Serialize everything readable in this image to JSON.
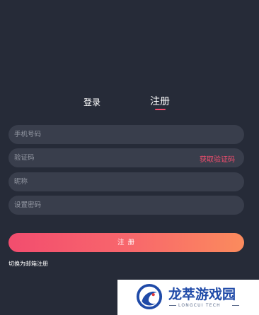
{
  "tabs": {
    "login": "登录",
    "register": "注册",
    "active": "register"
  },
  "form": {
    "phone_placeholder": "手机号码",
    "code_placeholder": "验证码",
    "get_code": "获取验证码",
    "nickname_placeholder": "昵称",
    "password_placeholder": "设置密码",
    "submit": "注 册",
    "switch_email": "切换为邮箱注册"
  },
  "colors": {
    "background": "#262b38",
    "field_bg": "#393e4c",
    "accent": "#f24d6e",
    "gradient_end": "#fb8b5d"
  },
  "watermark": {
    "name": "龙萃游戏园",
    "sub": "LONGCUI TECH",
    "icon": "dragon-logo-icon"
  }
}
